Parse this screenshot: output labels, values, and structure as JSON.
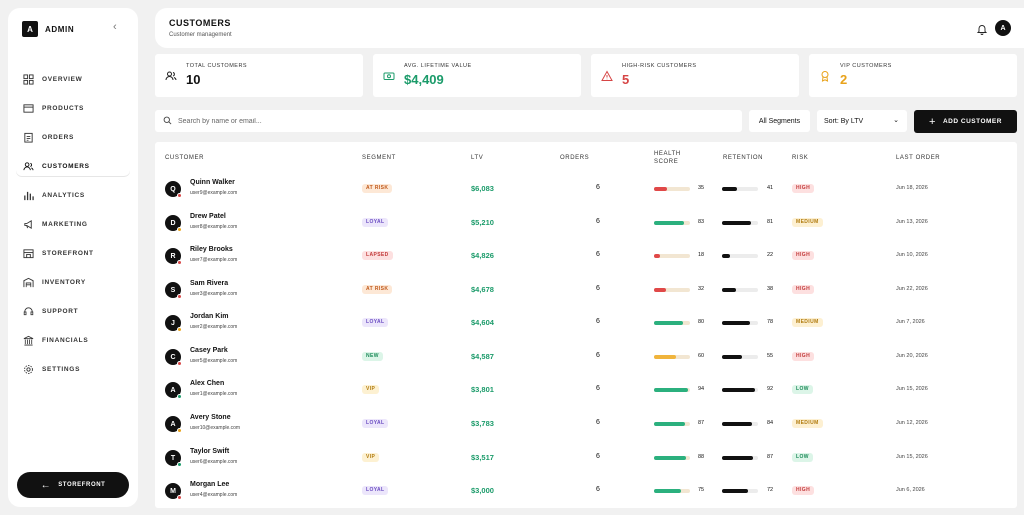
{
  "brand": {
    "logo": "A",
    "name": "ADMIN"
  },
  "nav": [
    {
      "label": "OVERVIEW",
      "icon": "grid-icon"
    },
    {
      "label": "PRODUCTS",
      "icon": "box-icon"
    },
    {
      "label": "ORDERS",
      "icon": "clipboard-icon"
    },
    {
      "label": "CUSTOMERS",
      "icon": "users-icon",
      "active": true
    },
    {
      "label": "ANALYTICS",
      "icon": "bar-chart-icon"
    },
    {
      "label": "MARKETING",
      "icon": "megaphone-icon"
    },
    {
      "label": "STOREFRONT",
      "icon": "store-icon"
    },
    {
      "label": "INVENTORY",
      "icon": "warehouse-icon"
    },
    {
      "label": "SUPPORT",
      "icon": "support-icon"
    },
    {
      "label": "FINANCIALS",
      "icon": "bank-icon"
    },
    {
      "label": "SETTINGS",
      "icon": "gear-icon"
    }
  ],
  "storefront_button": "STOREFRONT",
  "header": {
    "title": "CUSTOMERS",
    "subtitle": "Customer management",
    "avatar": "A"
  },
  "stats": [
    {
      "label": "TOTAL CUSTOMERS",
      "value": "10",
      "color": "#111111",
      "icon": "users-icon"
    },
    {
      "label": "AVG. LIFETIME VALUE",
      "value": "$4,409",
      "color": "#1b9b6a",
      "icon": "money-icon"
    },
    {
      "label": "HIGH-RISK CUSTOMERS",
      "value": "5",
      "color": "#d64545",
      "icon": "warning-icon"
    },
    {
      "label": "VIP CUSTOMERS",
      "value": "2",
      "color": "#e8a21a",
      "icon": "award-icon"
    }
  ],
  "toolbar": {
    "search_placeholder": "Search by name or email...",
    "segment_filter": "All Segments",
    "sort": "Sort: By LTV",
    "add_button": "ADD CUSTOMER"
  },
  "columns": {
    "customer": "CUSTOMER",
    "segment": "SEGMENT",
    "ltv": "LTV",
    "orders": "ORDERS",
    "health_1": "HEALTH",
    "health_2": "SCORE",
    "retention": "RETENTION",
    "risk": "RISK",
    "last_order": "LAST ORDER"
  },
  "customers": [
    {
      "initial": "Q",
      "name": "Quinn Walker",
      "email": "user9@example.com",
      "segment": "AT RISK",
      "ltv": "$6,083",
      "orders": "6",
      "health": 35,
      "health_label": "35",
      "retention": 41,
      "retention_label": "41",
      "risk": "HIGH",
      "last_order": "Jun 18, 2026",
      "dot": "#d64545"
    },
    {
      "initial": "D",
      "name": "Drew Patel",
      "email": "user8@example.com",
      "segment": "LOYAL",
      "ltv": "$5,210",
      "orders": "6",
      "health": 83,
      "health_label": "83",
      "retention": 81,
      "retention_label": "81",
      "risk": "MEDIUM",
      "last_order": "Jun 13, 2026",
      "dot": "#e8a21a"
    },
    {
      "initial": "R",
      "name": "Riley Brooks",
      "email": "user7@example.com",
      "segment": "LAPSED",
      "ltv": "$4,826",
      "orders": "6",
      "health": 18,
      "health_label": "18",
      "retention": 22,
      "retention_label": "22",
      "risk": "HIGH",
      "last_order": "Jun 10, 2026",
      "dot": "#d64545"
    },
    {
      "initial": "S",
      "name": "Sam Rivera",
      "email": "user3@example.com",
      "segment": "AT RISK",
      "ltv": "$4,678",
      "orders": "6",
      "health": 32,
      "health_label": "32",
      "retention": 38,
      "retention_label": "38",
      "risk": "HIGH",
      "last_order": "Jun 22, 2026",
      "dot": "#d64545"
    },
    {
      "initial": "J",
      "name": "Jordan Kim",
      "email": "user2@example.com",
      "segment": "LOYAL",
      "ltv": "$4,604",
      "orders": "6",
      "health": 80,
      "health_label": "80",
      "retention": 78,
      "retention_label": "78",
      "risk": "MEDIUM",
      "last_order": "Jun 7, 2026",
      "dot": "#e8a21a"
    },
    {
      "initial": "C",
      "name": "Casey Park",
      "email": "user5@example.com",
      "segment": "NEW",
      "ltv": "$4,587",
      "orders": "6",
      "health": 60,
      "health_label": "60",
      "retention": 55,
      "retention_label": "55",
      "risk": "HIGH",
      "last_order": "Jun 20, 2026",
      "dot": "#d64545"
    },
    {
      "initial": "A",
      "name": "Alex Chen",
      "email": "user1@example.com",
      "segment": "VIP",
      "ltv": "$3,801",
      "orders": "6",
      "health": 94,
      "health_label": "94",
      "retention": 92,
      "retention_label": "92",
      "risk": "LOW",
      "last_order": "Jun 15, 2026",
      "dot": "#1b9b6a"
    },
    {
      "initial": "A",
      "name": "Avery Stone",
      "email": "user10@example.com",
      "segment": "LOYAL",
      "ltv": "$3,783",
      "orders": "6",
      "health": 87,
      "health_label": "87",
      "retention": 84,
      "retention_label": "84",
      "risk": "MEDIUM",
      "last_order": "Jun 12, 2026",
      "dot": "#e8a21a"
    },
    {
      "initial": "T",
      "name": "Taylor Swift",
      "email": "user6@example.com",
      "segment": "VIP",
      "ltv": "$3,517",
      "orders": "6",
      "health": 88,
      "health_label": "88",
      "retention": 87,
      "retention_label": "87",
      "risk": "LOW",
      "last_order": "Jun 15, 2026",
      "dot": "#1b9b6a"
    },
    {
      "initial": "M",
      "name": "Morgan Lee",
      "email": "user4@example.com",
      "segment": "LOYAL",
      "ltv": "$3,000",
      "orders": "6",
      "health": 75,
      "health_label": "75",
      "retention": 72,
      "retention_label": "72",
      "risk": "HIGH",
      "last_order": "Jun 6, 2026",
      "dot": "#d64545"
    }
  ],
  "segment_colors": {
    "AT RISK": {
      "bg": "#fde8d6",
      "fg": "#c0581a"
    },
    "LOYAL": {
      "bg": "#ece6fb",
      "fg": "#6a4cc2"
    },
    "LAPSED": {
      "bg": "#fde0e0",
      "fg": "#c23b3b"
    },
    "NEW": {
      "bg": "#dcf5e8",
      "fg": "#1b8a58"
    },
    "VIP": {
      "bg": "#fdf1d2",
      "fg": "#b07a0c"
    }
  },
  "risk_colors": {
    "HIGH": {
      "bg": "#fde0e0",
      "fg": "#c23b3b"
    },
    "MEDIUM": {
      "bg": "#fdf0d2",
      "fg": "#b07a0c"
    },
    "LOW": {
      "bg": "#dcf5e8",
      "fg": "#1b8a58"
    }
  },
  "health_colors": {
    "low": "#e04848",
    "mid": "#f0b43c",
    "high": "#2bb07e"
  }
}
